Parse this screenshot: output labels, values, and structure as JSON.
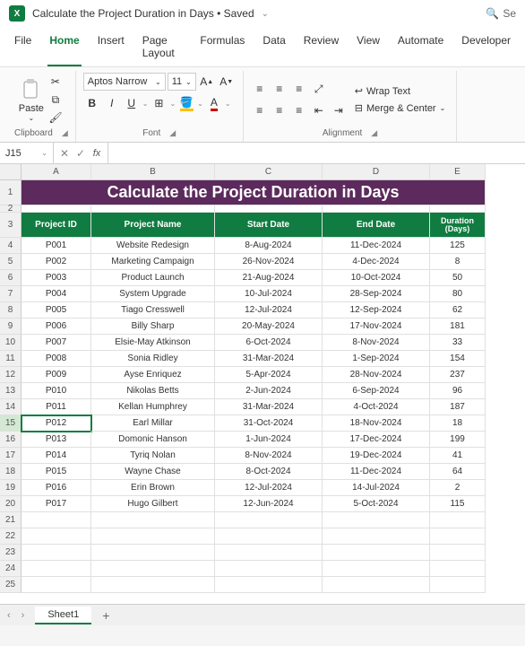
{
  "titlebar": {
    "title": "Calculate the Project Duration in Days • Saved",
    "search_hint": "Se"
  },
  "tabs": [
    "File",
    "Home",
    "Insert",
    "Page Layout",
    "Formulas",
    "Data",
    "Review",
    "View",
    "Automate",
    "Developer"
  ],
  "active_tab": "Home",
  "ribbon": {
    "clipboard": {
      "paste": "Paste",
      "label": "Clipboard"
    },
    "font": {
      "name": "Aptos Narrow",
      "size": "11",
      "label": "Font"
    },
    "align": {
      "wrap": "Wrap Text",
      "merge": "Merge & Center",
      "label": "Alignment"
    }
  },
  "formula_bar": {
    "name_box": "J15",
    "formula": ""
  },
  "columns": [
    "A",
    "B",
    "C",
    "D",
    "E"
  ],
  "sheet_title": "Calculate the Project Duration in Days",
  "headers": {
    "a": "Project ID",
    "b": "Project Name",
    "c": "Start Date",
    "d": "End Date",
    "e1": "Duration",
    "e2": "(Days)"
  },
  "rows": [
    {
      "id": "P001",
      "name": "Website Redesign",
      "start": "8-Aug-2024",
      "end": "11-Dec-2024",
      "dur": "125"
    },
    {
      "id": "P002",
      "name": "Marketing Campaign",
      "start": "26-Nov-2024",
      "end": "4-Dec-2024",
      "dur": "8"
    },
    {
      "id": "P003",
      "name": "Product Launch",
      "start": "21-Aug-2024",
      "end": "10-Oct-2024",
      "dur": "50"
    },
    {
      "id": "P004",
      "name": "System Upgrade",
      "start": "10-Jul-2024",
      "end": "28-Sep-2024",
      "dur": "80"
    },
    {
      "id": "P005",
      "name": "Tiago Cresswell",
      "start": "12-Jul-2024",
      "end": "12-Sep-2024",
      "dur": "62"
    },
    {
      "id": "P006",
      "name": "Billy Sharp",
      "start": "20-May-2024",
      "end": "17-Nov-2024",
      "dur": "181"
    },
    {
      "id": "P007",
      "name": "Elsie-May Atkinson",
      "start": "6-Oct-2024",
      "end": "8-Nov-2024",
      "dur": "33"
    },
    {
      "id": "P008",
      "name": "Sonia Ridley",
      "start": "31-Mar-2024",
      "end": "1-Sep-2024",
      "dur": "154"
    },
    {
      "id": "P009",
      "name": "Ayse Enriquez",
      "start": "5-Apr-2024",
      "end": "28-Nov-2024",
      "dur": "237"
    },
    {
      "id": "P010",
      "name": "Nikolas Betts",
      "start": "2-Jun-2024",
      "end": "6-Sep-2024",
      "dur": "96"
    },
    {
      "id": "P011",
      "name": "Kellan Humphrey",
      "start": "31-Mar-2024",
      "end": "4-Oct-2024",
      "dur": "187"
    },
    {
      "id": "P012",
      "name": "Earl Millar",
      "start": "31-Oct-2024",
      "end": "18-Nov-2024",
      "dur": "18"
    },
    {
      "id": "P013",
      "name": "Domonic Hanson",
      "start": "1-Jun-2024",
      "end": "17-Dec-2024",
      "dur": "199"
    },
    {
      "id": "P014",
      "name": "Tyriq Nolan",
      "start": "8-Nov-2024",
      "end": "19-Dec-2024",
      "dur": "41"
    },
    {
      "id": "P015",
      "name": "Wayne Chase",
      "start": "8-Oct-2024",
      "end": "11-Dec-2024",
      "dur": "64"
    },
    {
      "id": "P016",
      "name": "Erin Brown",
      "start": "12-Jul-2024",
      "end": "14-Jul-2024",
      "dur": "2"
    },
    {
      "id": "P017",
      "name": "Hugo Gilbert",
      "start": "12-Jun-2024",
      "end": "5-Oct-2024",
      "dur": "115"
    }
  ],
  "selected_row": 15,
  "sheet_tab": "Sheet1",
  "chart_data": {
    "type": "table",
    "title": "Calculate the Project Duration in Days",
    "columns": [
      "Project ID",
      "Project Name",
      "Start Date",
      "End Date",
      "Duration (Days)"
    ],
    "data": [
      [
        "P001",
        "Website Redesign",
        "8-Aug-2024",
        "11-Dec-2024",
        125
      ],
      [
        "P002",
        "Marketing Campaign",
        "26-Nov-2024",
        "4-Dec-2024",
        8
      ],
      [
        "P003",
        "Product Launch",
        "21-Aug-2024",
        "10-Oct-2024",
        50
      ],
      [
        "P004",
        "System Upgrade",
        "10-Jul-2024",
        "28-Sep-2024",
        80
      ],
      [
        "P005",
        "Tiago Cresswell",
        "12-Jul-2024",
        "12-Sep-2024",
        62
      ],
      [
        "P006",
        "Billy Sharp",
        "20-May-2024",
        "17-Nov-2024",
        181
      ],
      [
        "P007",
        "Elsie-May Atkinson",
        "6-Oct-2024",
        "8-Nov-2024",
        33
      ],
      [
        "P008",
        "Sonia Ridley",
        "31-Mar-2024",
        "1-Sep-2024",
        154
      ],
      [
        "P009",
        "Ayse Enriquez",
        "5-Apr-2024",
        "28-Nov-2024",
        237
      ],
      [
        "P010",
        "Nikolas Betts",
        "2-Jun-2024",
        "6-Sep-2024",
        96
      ],
      [
        "P011",
        "Kellan Humphrey",
        "31-Mar-2024",
        "4-Oct-2024",
        187
      ],
      [
        "P012",
        "Earl Millar",
        "31-Oct-2024",
        "18-Nov-2024",
        18
      ],
      [
        "P013",
        "Domonic Hanson",
        "1-Jun-2024",
        "17-Dec-2024",
        199
      ],
      [
        "P014",
        "Tyriq Nolan",
        "8-Nov-2024",
        "19-Dec-2024",
        41
      ],
      [
        "P015",
        "Wayne Chase",
        "8-Oct-2024",
        "11-Dec-2024",
        64
      ],
      [
        "P016",
        "Erin Brown",
        "12-Jul-2024",
        "14-Jul-2024",
        2
      ],
      [
        "P017",
        "Hugo Gilbert",
        "12-Jun-2024",
        "5-Oct-2024",
        115
      ]
    ]
  }
}
